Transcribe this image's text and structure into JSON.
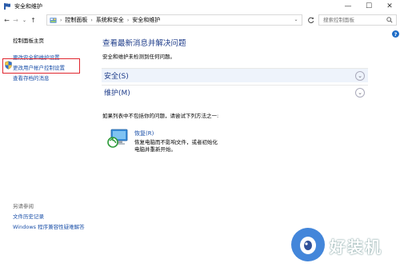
{
  "window": {
    "title": "安全和维护",
    "minimize": "—",
    "maximize": "☐",
    "close": "✕"
  },
  "nav": {
    "back": "←",
    "forward": "→",
    "recent": "⌄",
    "up": "↑",
    "breadcrumbs": [
      "控制面板",
      "系统和安全",
      "安全和维护"
    ],
    "breadcrumb_sep": "›",
    "search_placeholder": "搜索控制面板",
    "help": "?"
  },
  "sidebar": {
    "home": "控制面板主页",
    "items": [
      {
        "label": "更改安全和维护设置"
      },
      {
        "label": "更改用户帐户控制设置"
      },
      {
        "label": "查看存档的消息"
      }
    ],
    "see_also_title": "另请参阅",
    "see_also": [
      {
        "label": "文件历史记录"
      },
      {
        "label": "Windows 程序兼容性疑难解答"
      }
    ]
  },
  "main": {
    "title": "查看最新消息并解决问题",
    "subtitle": "安全和维护未检测到任何问题。",
    "sections": [
      {
        "label": "安全(S)"
      },
      {
        "label": "维护(M)"
      }
    ],
    "hint": "如果列表中不包括你的问题，请尝试下列方法之一:",
    "recovery": {
      "title": "恢复(R)",
      "description": "恢复电脑而不影响文件，或者初始化电脑并重新开始。"
    }
  },
  "watermark": {
    "text": "好装机"
  },
  "colors": {
    "link": "#1a4fa8",
    "heading": "#1e3c8a",
    "highlight_box": "#e0262f",
    "section_hover": "#eef3fb"
  }
}
